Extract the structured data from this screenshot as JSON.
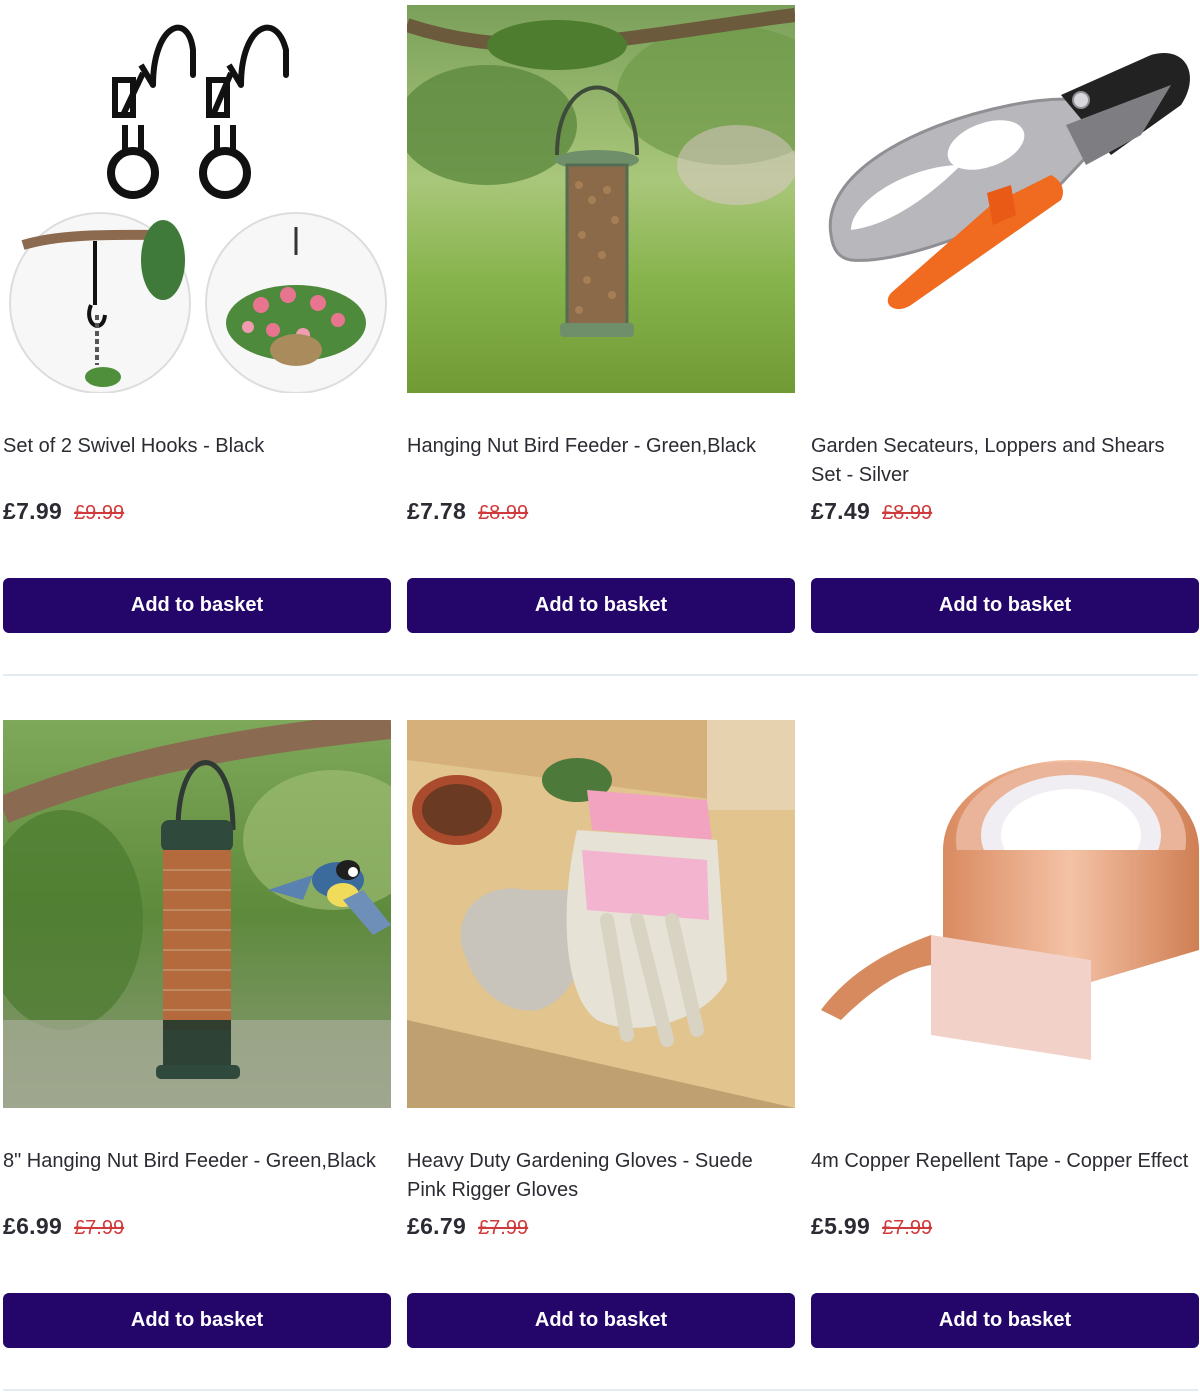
{
  "products": [
    {
      "title": "Set of 2 Swivel Hooks - Black",
      "price": "£7.99",
      "old_price": "£9.99",
      "button_label": "Add to basket",
      "image": "swivel-hooks-image"
    },
    {
      "title": "Hanging Nut Bird Feeder - Green,Black",
      "price": "£7.78",
      "old_price": "£8.99",
      "button_label": "Add to basket",
      "image": "nut-bird-feeder-image"
    },
    {
      "title": "Garden Secateurs, Loppers and Shears Set - Silver",
      "price": "£7.49",
      "old_price": "£8.99",
      "button_label": "Add to basket",
      "image": "secateurs-image"
    },
    {
      "title": "8\" Hanging Nut Bird Feeder - Green,Black",
      "price": "£6.99",
      "old_price": "£7.99",
      "button_label": "Add to basket",
      "image": "bird-feeder-with-bird-image"
    },
    {
      "title": "Heavy Duty Gardening Gloves - Suede Pink Rigger Gloves",
      "price": "£6.79",
      "old_price": "£7.99",
      "button_label": "Add to basket",
      "image": "gardening-gloves-image"
    },
    {
      "title": "4m Copper Repellent Tape - Copper Effect",
      "price": "£5.99",
      "old_price": "£7.99",
      "button_label": "Add to basket",
      "image": "copper-tape-image"
    }
  ],
  "colors": {
    "button_bg": "#24066b",
    "button_text": "#ffffff",
    "old_price": "#d13a3a",
    "text": "#2b2b33",
    "divider": "#e3ecf0"
  }
}
